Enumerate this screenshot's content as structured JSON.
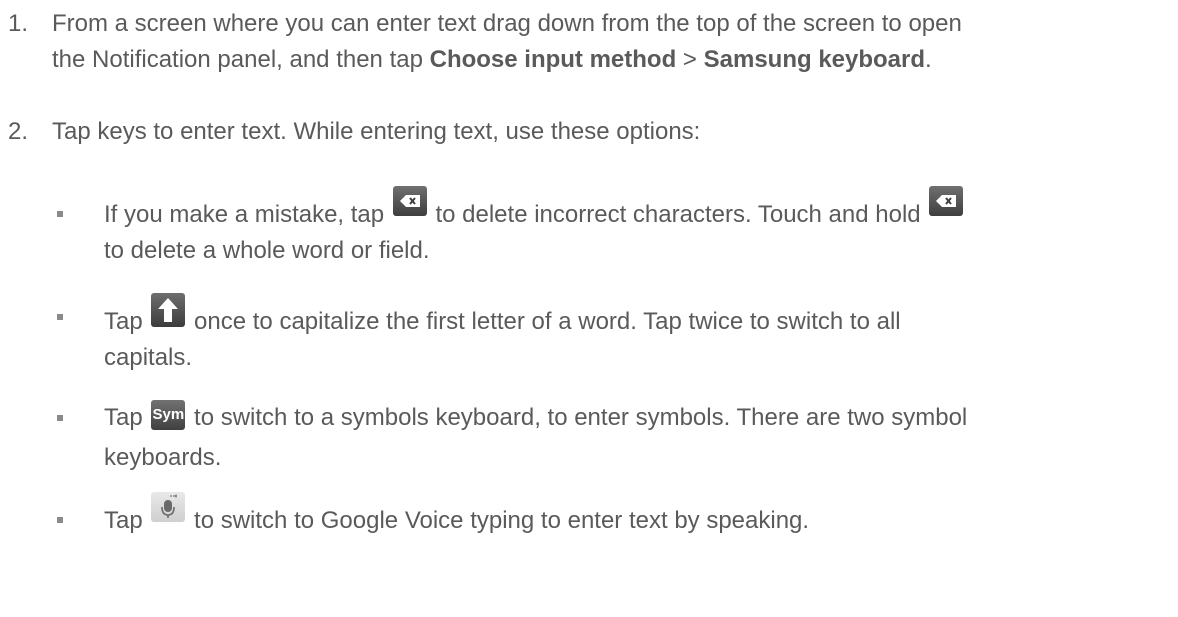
{
  "steps": [
    {
      "number": "1.",
      "line1_a": "From a screen where you can enter text drag down from the top of the screen to open",
      "line2_a": "the Notification panel, and then tap ",
      "bold1": "Choose input method",
      "sep": " > ",
      "bold2": "Samsung keyboard",
      "end": "."
    },
    {
      "number": "2.",
      "text": "Tap keys to enter text. While entering text, use these options:"
    }
  ],
  "bullets": [
    {
      "part1": "If you make a mistake, tap ",
      "part2": " to delete incorrect characters. Touch and hold ",
      "part3": "to delete a whole word or field.",
      "icon": "delete-key-icon"
    },
    {
      "part1": "Tap ",
      "part2": " once to capitalize the first letter of a word. Tap twice to switch to all",
      "part3": "capitals.",
      "icon": "shift-key-icon"
    },
    {
      "part1": "Tap ",
      "key_label": "Sym",
      "part2": " to switch to a symbols keyboard, to enter symbols. There are two symbol",
      "part3": "keyboards.",
      "icon": "sym-key-icon"
    },
    {
      "part1": "Tap ",
      "part2": " to switch to Google Voice typing to enter text by speaking.",
      "icon": "voice-input-key-icon"
    }
  ]
}
